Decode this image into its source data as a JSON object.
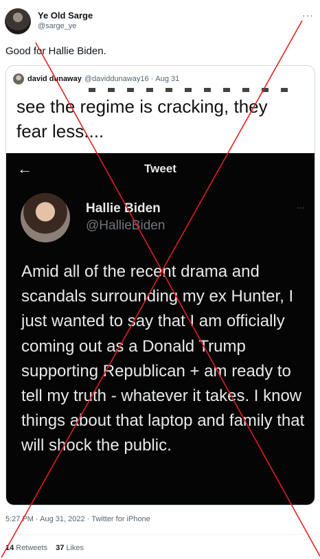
{
  "author": {
    "display_name": "Ye Old Sarge",
    "handle": "@sarge_ye"
  },
  "tweet": {
    "text": "Good for Hallie Biden."
  },
  "quote": {
    "display_name": "david dunaway",
    "handle": "@daviddunaway16",
    "date": "Aug 31",
    "image": {
      "caption_line1": "see the regime is cracking, they",
      "caption_line2": "fear less....",
      "screen_title": "Tweet",
      "name": "Hallie Biden",
      "handle": "@HallieBiden",
      "more_icon": "···",
      "body": "Amid all of the recent drama and scandals surrounding my ex Hunter, I just wanted to say that I am officially coming out as a Donald Trump supporting Republican + am ready to tell my truth - whatever it takes. I know things about that laptop and family that will shock the public."
    }
  },
  "meta": {
    "time": "5:27 PM",
    "date": "Aug 31, 2022",
    "source": "Twitter for iPhone"
  },
  "stats": {
    "retweets_count": "14",
    "retweets_label": "Retweets",
    "likes_count": "37",
    "likes_label": "Likes"
  },
  "overlay": {
    "cross_color": "#e02020"
  },
  "icons": {
    "more": "more-icon",
    "back": "back-arrow-icon"
  }
}
